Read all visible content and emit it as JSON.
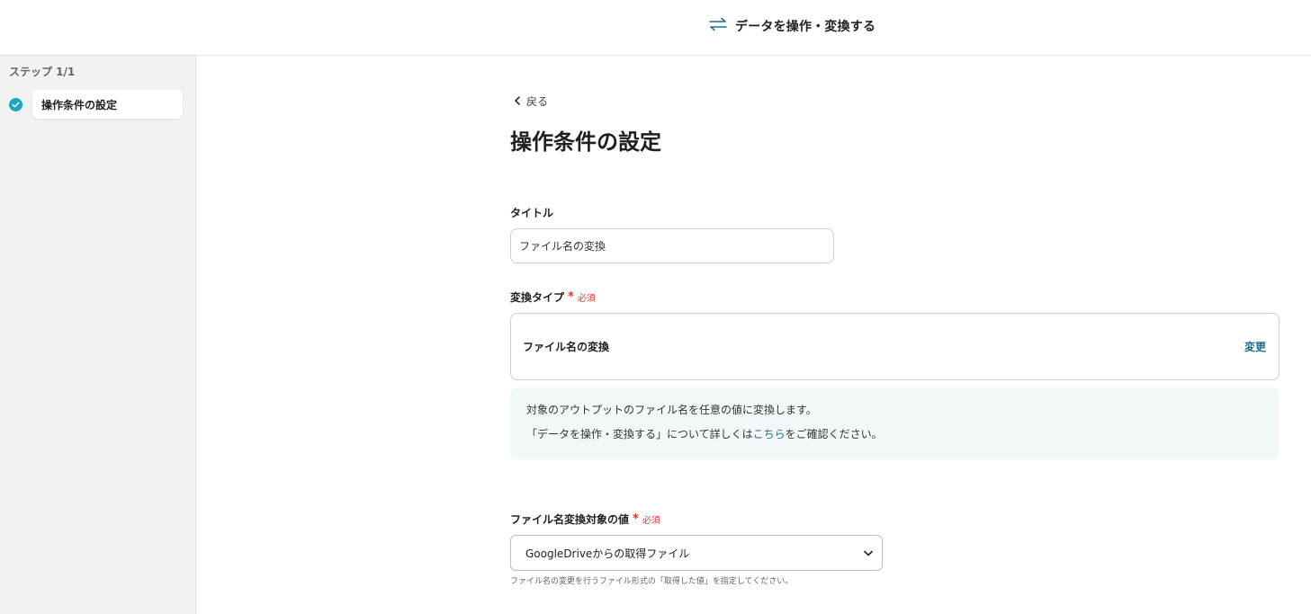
{
  "header": {
    "title": "データを操作・変換する",
    "icon": "swap-arrows-icon",
    "accent": "#1d6e8c"
  },
  "sidebar": {
    "step_count": "ステップ 1/1",
    "steps": [
      {
        "label": "操作条件の設定",
        "status": "completed"
      }
    ],
    "check_color": "#19a7c4"
  },
  "main": {
    "back_label": "戻る",
    "page_title": "操作条件の設定",
    "title_field": {
      "label": "タイトル",
      "value": "ファイル名の変換"
    },
    "conversion_type": {
      "label": "変換タイプ",
      "required_mark": "*",
      "required_text": "必須",
      "value": "ファイル名の変換",
      "change_label": "変更"
    },
    "info": {
      "line1": "対象のアウトプットのファイル名を任意の値に変換します。",
      "line2_prefix": "「データを操作・変換する」について詳しくは",
      "line2_link": "こちら",
      "line2_suffix": "をご確認ください。"
    },
    "target_value": {
      "label": "ファイル名変換対象の値",
      "required_mark": "*",
      "required_text": "必須",
      "selected": "GoogleDriveからの取得ファイル",
      "hint": "ファイル名の変更を行うファイル形式の「取得した値」を指定してください。"
    }
  }
}
